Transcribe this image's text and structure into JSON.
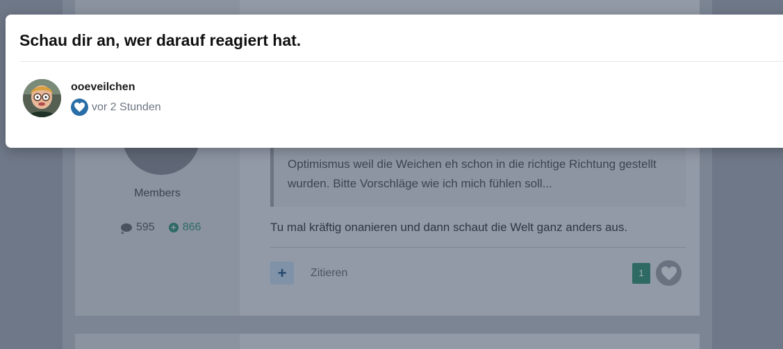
{
  "modal": {
    "title": "Schau dir an, wer darauf reagiert hat.",
    "reactions": [
      {
        "username": "ooeveilchen",
        "reaction_icon": "heart-icon",
        "time": "vor 2 Stunden"
      }
    ]
  },
  "post": {
    "author_group": "Members",
    "post_count": "595",
    "reputation": "866",
    "quote_text": "Optimismus weil die Weichen eh schon in die richtige Richtung gestellt wurden. Bitte Vorschläge wie ich mich fühlen soll...",
    "reply_text": "Tu mal kräftig onanieren und dann schaut die Welt ganz anders aus.",
    "add_label": "+",
    "quote_label": "Zitieren",
    "reaction_count": "1"
  },
  "colors": {
    "reaction_blue": "#2a6ea8",
    "reputation_green": "#2e6a63"
  }
}
